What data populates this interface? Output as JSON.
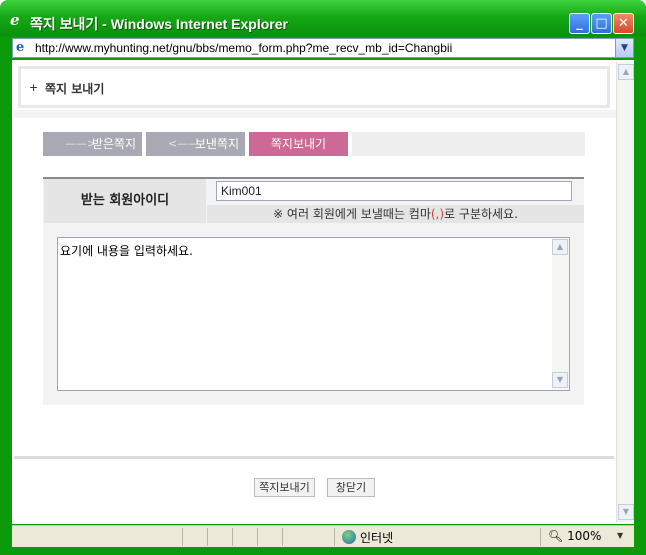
{
  "window": {
    "title": "쪽지 보내기 - Windows Internet Explorer",
    "url": "http://www.myhunting.net/gnu/bbs/memo_form.php?me_recv_mb_id=Changbii"
  },
  "page": {
    "header_plus": "+",
    "header_title": "쪽지 보내기"
  },
  "tabs": [
    {
      "label": "받은쪽지",
      "arrow": "——>"
    },
    {
      "label": "보낸쪽지",
      "arrow": "<——"
    },
    {
      "label": "쪽지보내기"
    }
  ],
  "form": {
    "recipient_label": "받는 회원아이디",
    "recipient_value": "Kim001",
    "note_prefix": "※ 여러 회원에게 보낼때는 컴마",
    "note_comma": "(,)",
    "note_suffix": "로 구분하세요.",
    "memo_value": "요기에 내용을 입력하세요."
  },
  "buttons": {
    "send": "쪽지보내기",
    "close": "창닫기"
  },
  "statusbar": {
    "zone": "인터넷",
    "zoom": "100%"
  },
  "colors": {
    "title_bar": "#16a816",
    "active_tab": "#cc6994",
    "inactive_tab": "#a9a9b3"
  }
}
